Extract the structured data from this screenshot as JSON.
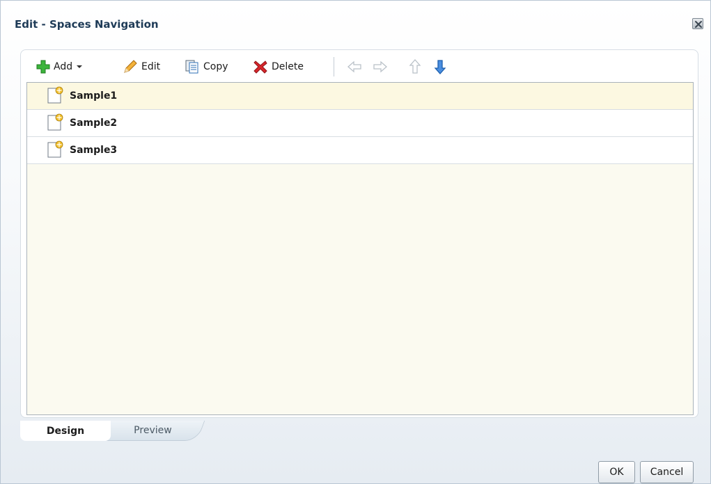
{
  "dialog": {
    "title": "Edit - Spaces Navigation",
    "close_icon": "close-icon"
  },
  "toolbar": {
    "add_label": "Add",
    "edit_label": "Edit",
    "copy_label": "Copy",
    "delete_label": "Delete",
    "icons": [
      "add-icon",
      "chevron-down-icon",
      "pencil-icon",
      "copy-icon",
      "delete-icon",
      "arrow-left-icon",
      "arrow-right-icon",
      "arrow-up-icon",
      "arrow-down-icon"
    ]
  },
  "tree": {
    "items": [
      {
        "label": "Sample1",
        "selected": true
      },
      {
        "label": "Sample2",
        "selected": false
      },
      {
        "label": "Sample3",
        "selected": false
      }
    ]
  },
  "tabs": [
    {
      "label": "Design",
      "active": true
    },
    {
      "label": "Preview",
      "active": false
    }
  ],
  "buttons": {
    "ok_label": "OK",
    "cancel_label": "Cancel"
  },
  "colors": {
    "title": "#1e3b57",
    "selected_row": "#fcf8e1",
    "tree_bg": "#fbfaf0",
    "add_green": "#2fa52f",
    "delete_red": "#d8262b",
    "arrow_blue": "#2f7ad6"
  }
}
